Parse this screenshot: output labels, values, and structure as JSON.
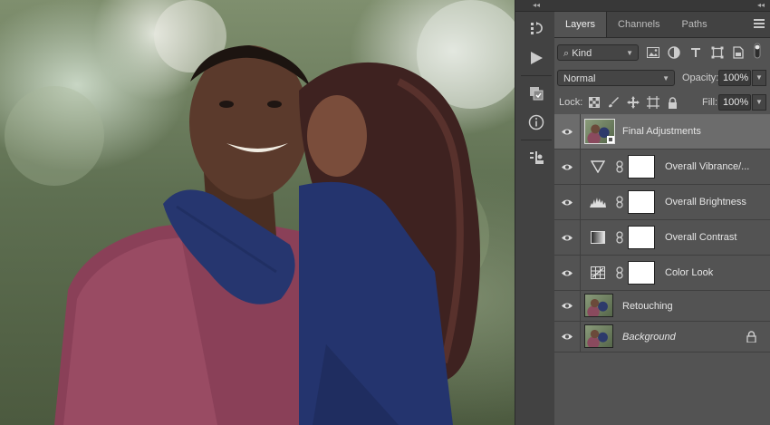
{
  "tabs": [
    {
      "label": "Layers",
      "active": true
    },
    {
      "label": "Channels",
      "active": false
    },
    {
      "label": "Paths",
      "active": false
    }
  ],
  "filter": {
    "kind_label": "Kind"
  },
  "blend": {
    "mode": "Normal",
    "opacity_label": "Opacity:",
    "opacity_value": "100%"
  },
  "lock": {
    "label": "Lock:",
    "fill_label": "Fill:",
    "fill_value": "100%"
  },
  "layers": [
    {
      "name": "Final Adjustments",
      "type": "smart-object",
      "selected": true,
      "italic": false
    },
    {
      "name": "Overall Vibrance/...",
      "type": "vibrance-adjustment",
      "selected": false,
      "italic": false
    },
    {
      "name": "Overall Brightness",
      "type": "levels-adjustment",
      "selected": false,
      "italic": false
    },
    {
      "name": "Overall Contrast",
      "type": "gradient-map-adjustment",
      "selected": false,
      "italic": false
    },
    {
      "name": "Color Look",
      "type": "color-lookup-adjustment",
      "selected": false,
      "italic": false
    },
    {
      "name": "Retouching",
      "type": "pixel",
      "selected": false,
      "italic": false
    },
    {
      "name": "Background",
      "type": "background",
      "selected": false,
      "italic": true,
      "locked": true
    }
  ],
  "colors": {
    "panel_bg": "#535353",
    "selected_row": "#6c6c6c",
    "tab_bar": "#424242"
  }
}
